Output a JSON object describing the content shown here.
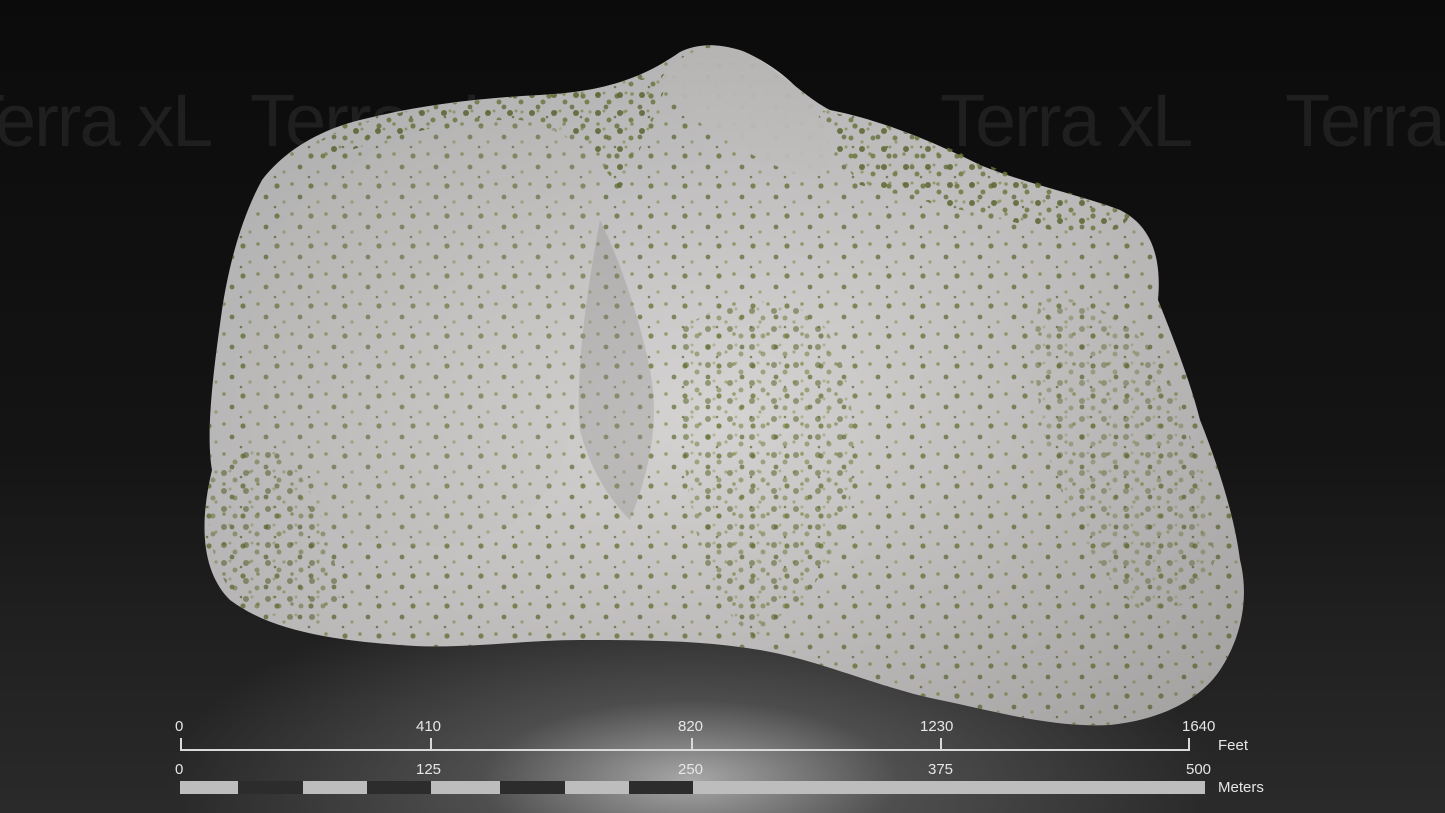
{
  "watermark": {
    "text": "Terra xL"
  },
  "model": {
    "icon": "3d-terrain-rock-model"
  },
  "scale_bar": {
    "feet": {
      "ticks": [
        "0",
        "410",
        "820",
        "1230",
        "1640"
      ],
      "unit": "Feet"
    },
    "meters": {
      "ticks": [
        "0",
        "125",
        "250",
        "375",
        "500"
      ],
      "unit": "Meters"
    },
    "colors": {
      "light": "#bdbdbd",
      "dark": "#2c2c2c",
      "line": "#d9d9d9"
    }
  }
}
